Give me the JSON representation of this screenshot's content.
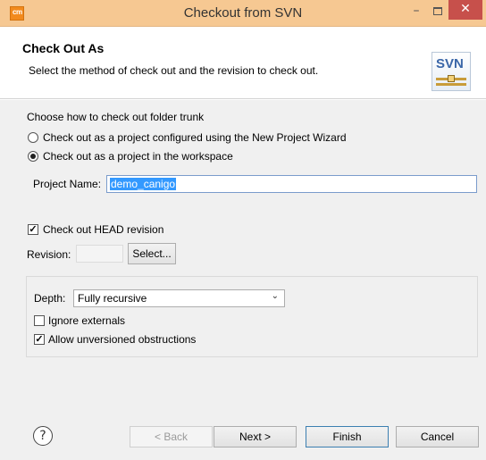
{
  "window": {
    "title": "Checkout from SVN",
    "app_icon_text": "cm",
    "minimize": "–",
    "close": "✕"
  },
  "header": {
    "title": "Check Out As",
    "description": "Select the method of check out and the revision to check out.",
    "logo_text": "SVN"
  },
  "checkout_method": {
    "prompt": "Choose how to check out folder trunk",
    "options": [
      {
        "label": "Check out as a project configured using the New Project Wizard",
        "selected": false
      },
      {
        "label": "Check out as a project in the workspace",
        "selected": true
      }
    ]
  },
  "project": {
    "label": "Project Name:",
    "value": "demo_canigo"
  },
  "revision": {
    "head_checkbox_label": "Check out HEAD revision",
    "head_checked": true,
    "label": "Revision:",
    "value": "",
    "select_button": "Select..."
  },
  "options": {
    "depth_label": "Depth:",
    "depth_value": "Fully recursive",
    "ignore_externals_label": "Ignore externals",
    "ignore_externals_checked": false,
    "allow_unversioned_label": "Allow unversioned obstructions",
    "allow_unversioned_checked": true
  },
  "footer": {
    "help": "?",
    "back": "< Back",
    "next": "Next >",
    "finish": "Finish",
    "cancel": "Cancel"
  },
  "colors": {
    "titlebar": "#f6c892",
    "close_button": "#c7504b",
    "selection": "#3399ff",
    "panel": "#f0f0f0"
  }
}
